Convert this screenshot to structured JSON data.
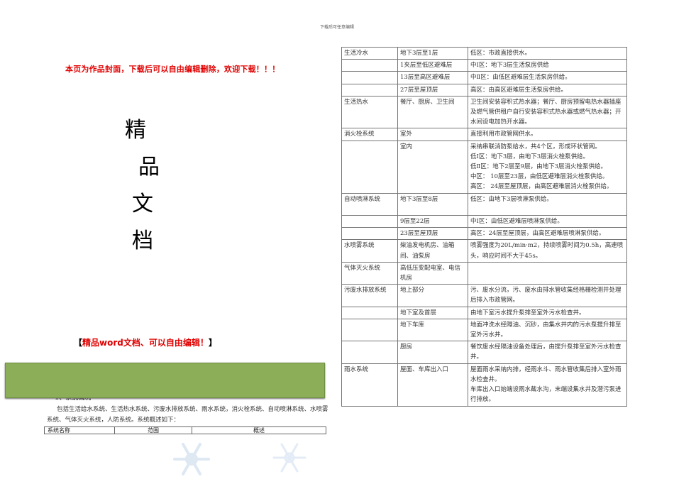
{
  "header_note": "下载后可任意编辑",
  "cover": {
    "notice": "本页为作品封面，下载后可以自由编辑删除，欢迎下载！！！",
    "title_chars": [
      "精",
      "品",
      "文",
      "档"
    ],
    "edit_note_open": "【",
    "edit_note_text": "精品word文档、可以自由编辑！",
    "edit_note_close": "】"
  },
  "overview": {
    "section_title": "1、系统概况",
    "paragraph": "包括生活给水系统、生活热水系统、污废水排放系统、雨水系统，消火栓系统、自动喷淋系统、水喷雾系统、气体灭火系统，人防系统。系统概述如下：",
    "table_headers": [
      "系统名称",
      "范围",
      "概述"
    ]
  },
  "systems": [
    {
      "name": "生活冷水",
      "range": "地下3层至1层",
      "desc": [
        "低区：市政直接供水。"
      ]
    },
    {
      "name": "",
      "range": "1夹层至低区避难层",
      "desc": [
        "中Ⅰ区：地下3层生活泵房供给"
      ]
    },
    {
      "name": "",
      "range": "13层至高区避难层",
      "desc": [
        "中Ⅱ区：由低区避难层生活泵房供给。"
      ]
    },
    {
      "name": "",
      "range": "27层至屋顶层",
      "desc": [
        "高区：由高区避难层生活泵房供给。"
      ]
    },
    {
      "name": "生活热水",
      "range": "餐厅、厨房、卫生间",
      "desc": [
        "卫生间安装容积式热水器；餐厅、厨房预留电热水器插座及燃气管供租户自行安装容积式热水器或燃气热水器；开水间设电加热开水器。"
      ]
    },
    {
      "name": "消火栓系统",
      "range": "室外",
      "desc": [
        "直接利用市政管网供水。"
      ]
    },
    {
      "name": "",
      "range": "室内",
      "desc": [
        "采纳串联消防泵给水，共4个区，形成环状管网。",
        "低Ⅰ区：地下3层，由地下3层消火栓泵供给。",
        "低Ⅱ区：地下2层至9层，由地下3层消火栓泵供给。",
        "中区： 10层至23层，由低区避难层消火栓泵供给。",
        "高区： 24层至屋顶层，由高区避难层消火栓泵供给。"
      ]
    },
    {
      "name": "自动喷淋系统",
      "range": "地下3层至8层",
      "desc": [
        "低区：由地下3层喷淋泵供给。",
        ""
      ]
    },
    {
      "name": "",
      "range": "9层至22层",
      "desc": [
        "中Ⅰ区：由低区避难层喷淋泵供给。"
      ]
    },
    {
      "name": "",
      "range": "23层至屋顶层",
      "desc": [
        "高区：24层至屋顶层，由高区避难层喷淋泵供给。"
      ]
    },
    {
      "name": "水喷雾系统",
      "range": "柴油发电机房、油箱间、油泵房",
      "desc": [
        "喷雾强度为20L/min·m2，持续喷雾时间为0.5h，高速喷头，响应时间不大于45s。"
      ]
    },
    {
      "name": "气体灭火系统",
      "range": "高低压变配电室、电信机房",
      "desc": [
        ""
      ]
    },
    {
      "name": "污废水排放系统",
      "range": "地上部分",
      "desc": [
        "污、废水分流，污、废水由排水管收集经格栅检测井处理后排入市政管网。"
      ]
    },
    {
      "name": "",
      "range": "地下室及首层",
      "desc": [
        "由地下室污水提升泵排至室外污水检查井。"
      ]
    },
    {
      "name": "",
      "range": "地下车库",
      "desc": [
        "地面冲洗水经隔油、沉砂，由集水井内的污水泵提升排至室外污水井。"
      ]
    },
    {
      "name": "",
      "range": "厨房",
      "desc": [
        "餐饮废水经隔油设备处理后，由提升泵排至室外污水检查井。"
      ]
    },
    {
      "name": "雨水系统",
      "range": "屋面、车库出入口",
      "desc": [
        "屋面雨水采纳内排，经雨水斗、雨水管收集后排入室外雨水检查井。",
        "车库出入口始端设雨水截水沟，末端设集水井及潜污泵进行排放。"
      ]
    }
  ],
  "colors": {
    "notice_red": "#e00000",
    "band_green": "#8cae58"
  },
  "icons": [
    "snowflake-icon"
  ]
}
